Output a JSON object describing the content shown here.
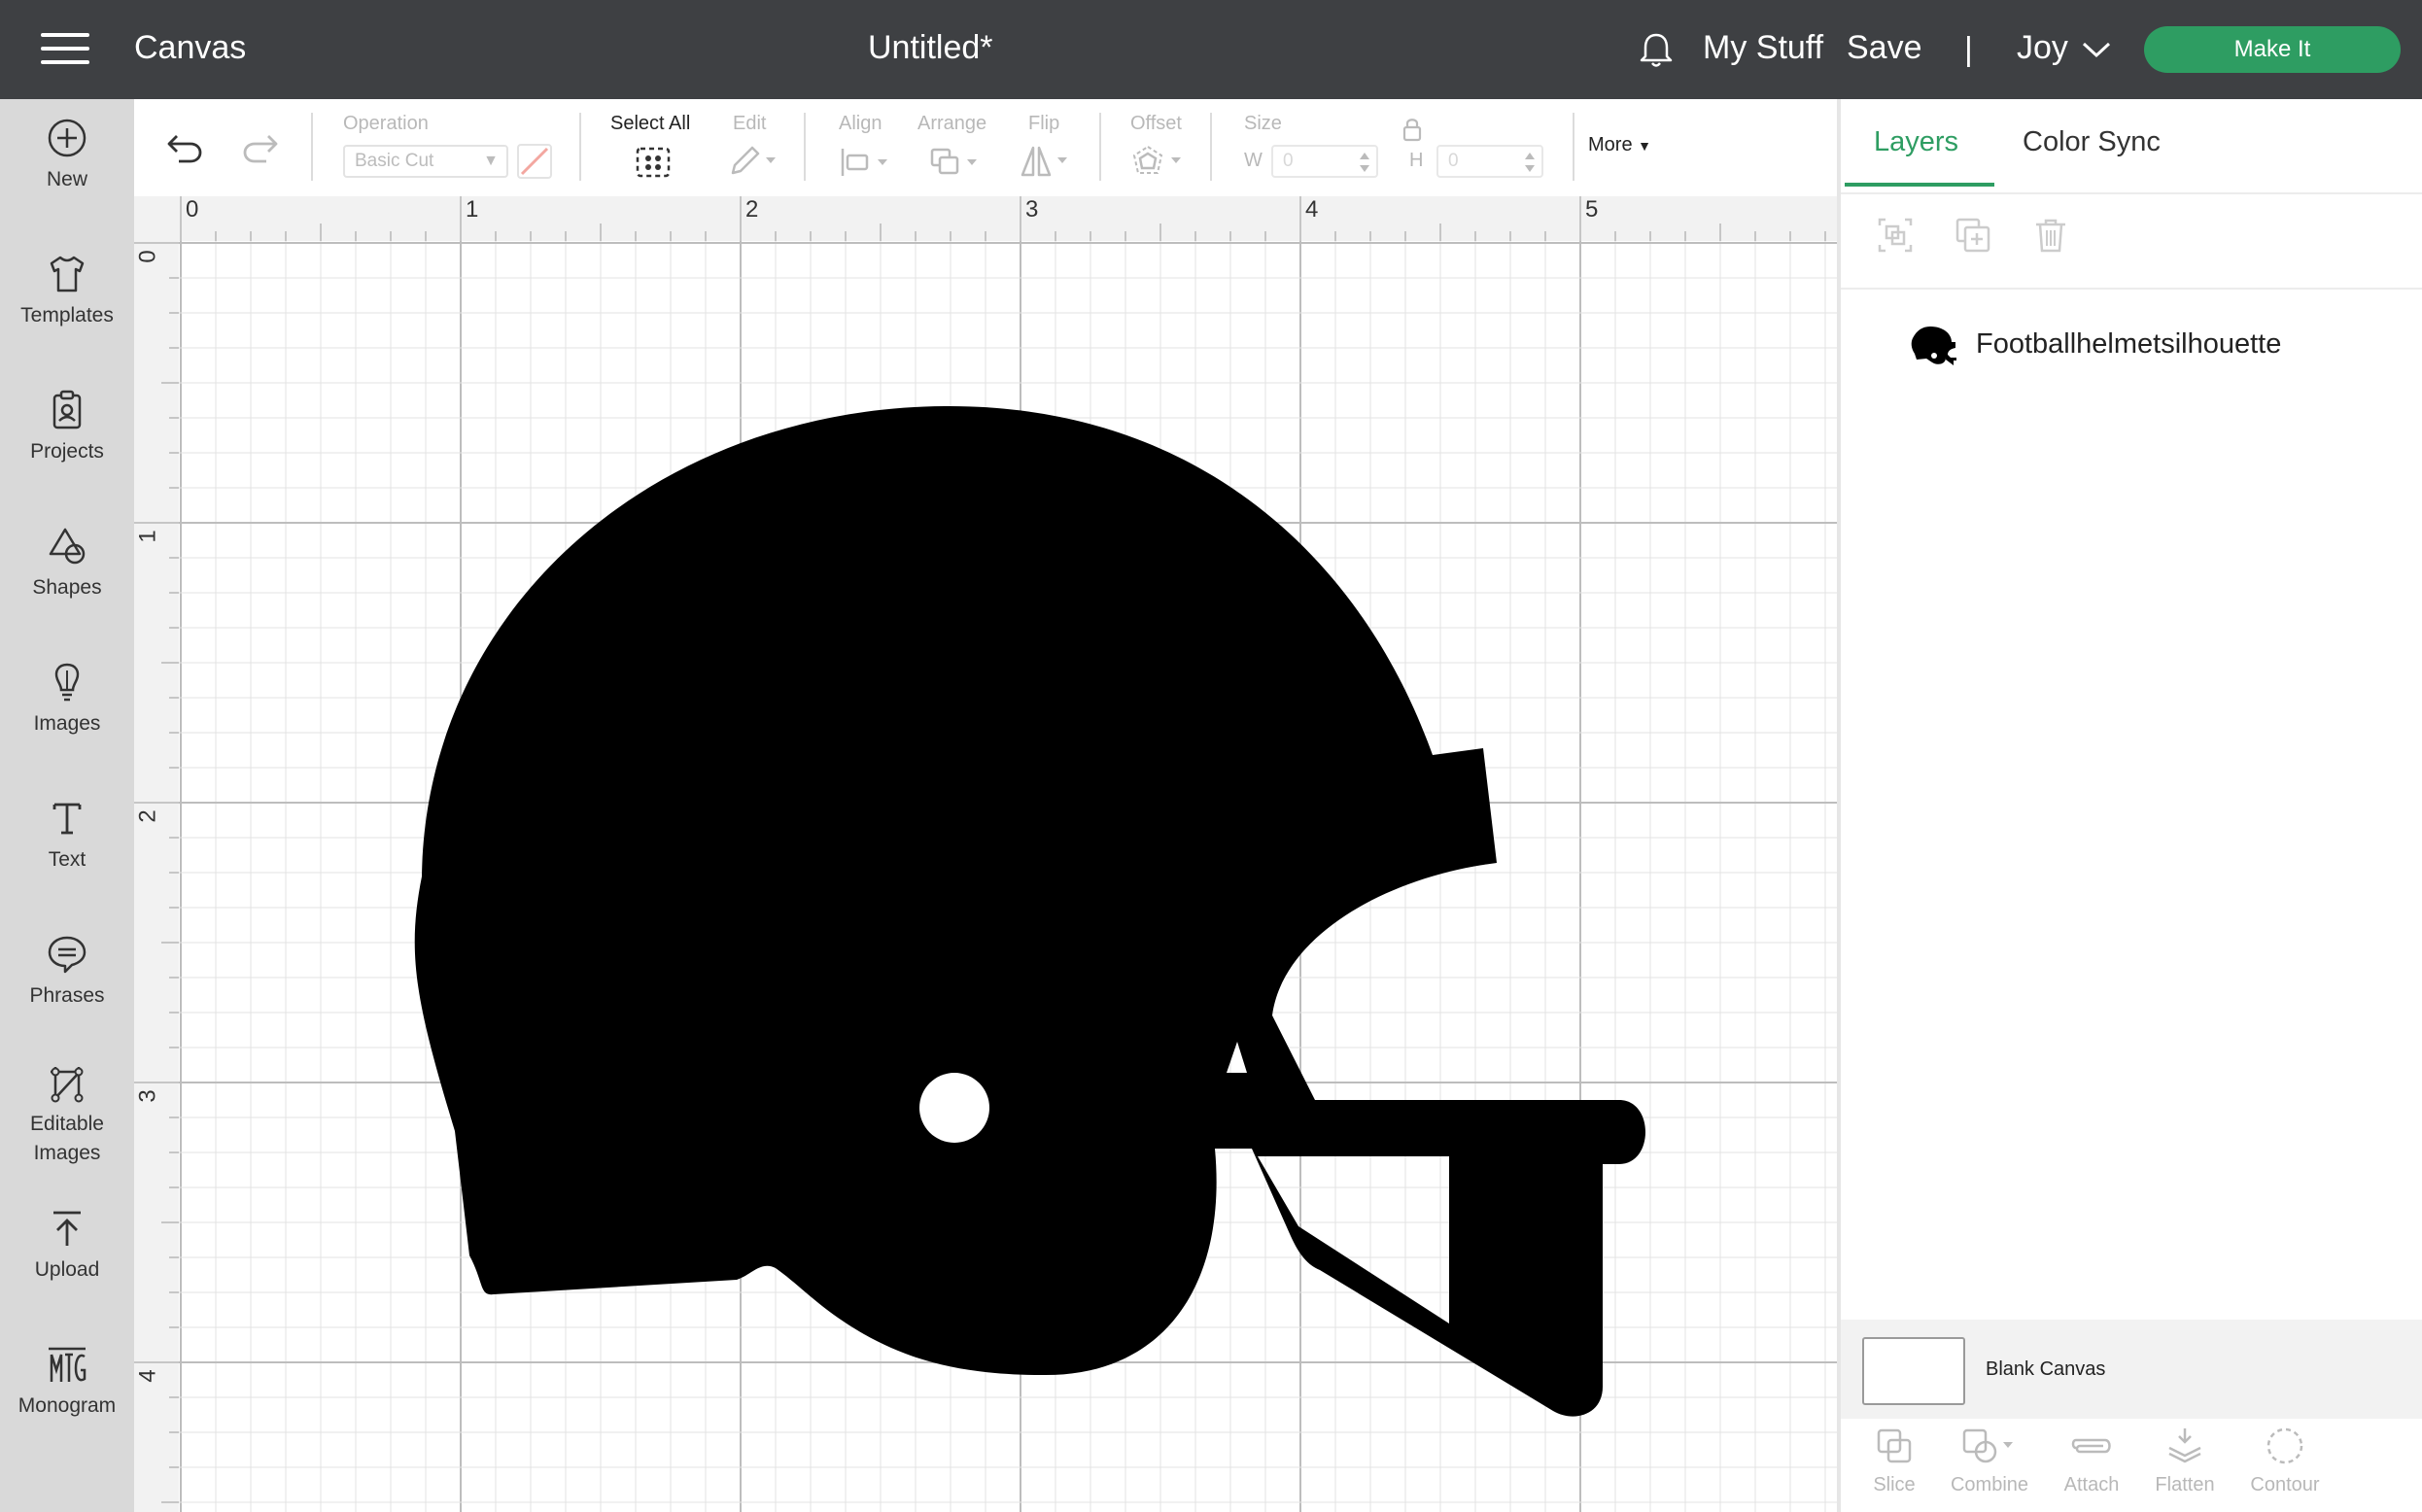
{
  "header": {
    "app_title": "Canvas",
    "document_title": "Untitled*",
    "my_stuff": "My Stuff",
    "save": "Save",
    "divider": "|",
    "user": "Joy",
    "make_it": "Make It"
  },
  "sidebar": {
    "items": [
      {
        "label": "New",
        "icon": "plus-circle-icon"
      },
      {
        "label": "Templates",
        "icon": "tshirt-icon"
      },
      {
        "label": "Projects",
        "icon": "clipboard-icon"
      },
      {
        "label": "Shapes",
        "icon": "shapes-icon"
      },
      {
        "label": "Images",
        "icon": "lightbulb-icon"
      },
      {
        "label": "Text",
        "icon": "text-icon"
      },
      {
        "label": "Phrases",
        "icon": "speech-bubble-icon"
      },
      {
        "label": "Editable Images",
        "icon": "editable-image-icon"
      },
      {
        "label": "Upload",
        "icon": "upload-icon"
      },
      {
        "label": "Monogram",
        "icon": "monogram-icon"
      }
    ]
  },
  "toolbar": {
    "operation_label": "Operation",
    "operation_value": "Basic Cut",
    "select_all_label": "Select All",
    "edit_label": "Edit",
    "align_label": "Align",
    "arrange_label": "Arrange",
    "flip_label": "Flip",
    "offset_label": "Offset",
    "size_label": "Size",
    "width_label": "W",
    "width_value": "0",
    "height_label": "H",
    "height_value": "0",
    "more_label": "More"
  },
  "canvas": {
    "ruler_top": [
      "0",
      "1",
      "2",
      "3",
      "4",
      "5"
    ],
    "ruler_left": [
      "0",
      "1",
      "2",
      "3",
      "4"
    ]
  },
  "right_panel": {
    "tabs": [
      "Layers",
      "Color Sync"
    ],
    "active_tab": "Layers",
    "layers": [
      {
        "name": "Footballhelmetsilhouette",
        "icon": "football-helmet-icon"
      }
    ],
    "blank_canvas_label": "Blank Canvas",
    "bottom_tools": [
      "Slice",
      "Combine",
      "Attach",
      "Flatten",
      "Contour"
    ]
  },
  "colors": {
    "header_bg": "#3e4043",
    "accent_green": "#2e9d62",
    "sidebar_bg": "#d9d9d9",
    "disabled_gray": "#b8b8b8"
  }
}
